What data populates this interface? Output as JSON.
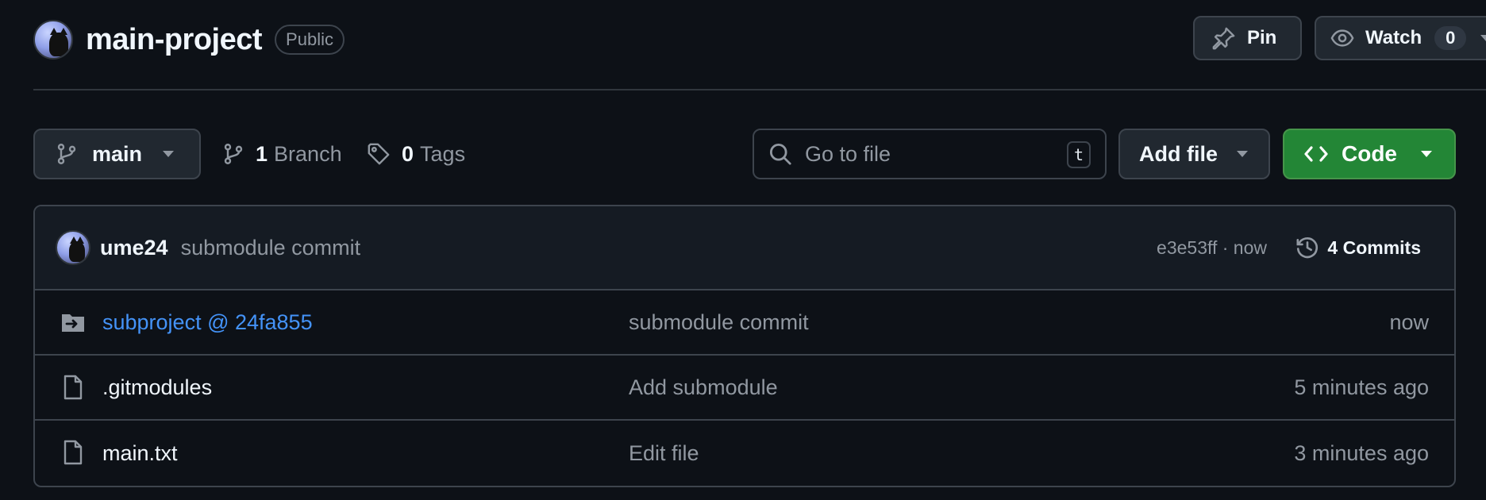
{
  "repo": {
    "name": "main-project",
    "visibility": "Public"
  },
  "header_actions": {
    "pin_label": "Pin",
    "watch_label": "Watch",
    "watch_count": "0"
  },
  "toolbar": {
    "branch": "main",
    "branches_count": "1",
    "branches_label": "Branch",
    "tags_count": "0",
    "tags_label": "Tags",
    "search_placeholder": "Go to file",
    "search_shortcut": "t",
    "add_file_label": "Add file",
    "code_label": "Code"
  },
  "latest_commit": {
    "author": "ume24",
    "message": "submodule commit",
    "hash_time": "e3e53ff · now",
    "commits_label": "4 Commits"
  },
  "files": [
    {
      "name": "subproject @ 24fa855",
      "type": "submodule",
      "commit": "submodule commit",
      "time": "now"
    },
    {
      "name": ".gitmodules",
      "type": "file",
      "commit": "Add submodule",
      "time": "5 minutes ago"
    },
    {
      "name": "main.txt",
      "type": "file",
      "commit": "Edit file",
      "time": "3 minutes ago"
    }
  ],
  "colors": {
    "background": "#0d1117",
    "border": "#3d444d",
    "link": "#4493f8",
    "primary_button": "#238636",
    "muted_text": "#9198a1"
  }
}
